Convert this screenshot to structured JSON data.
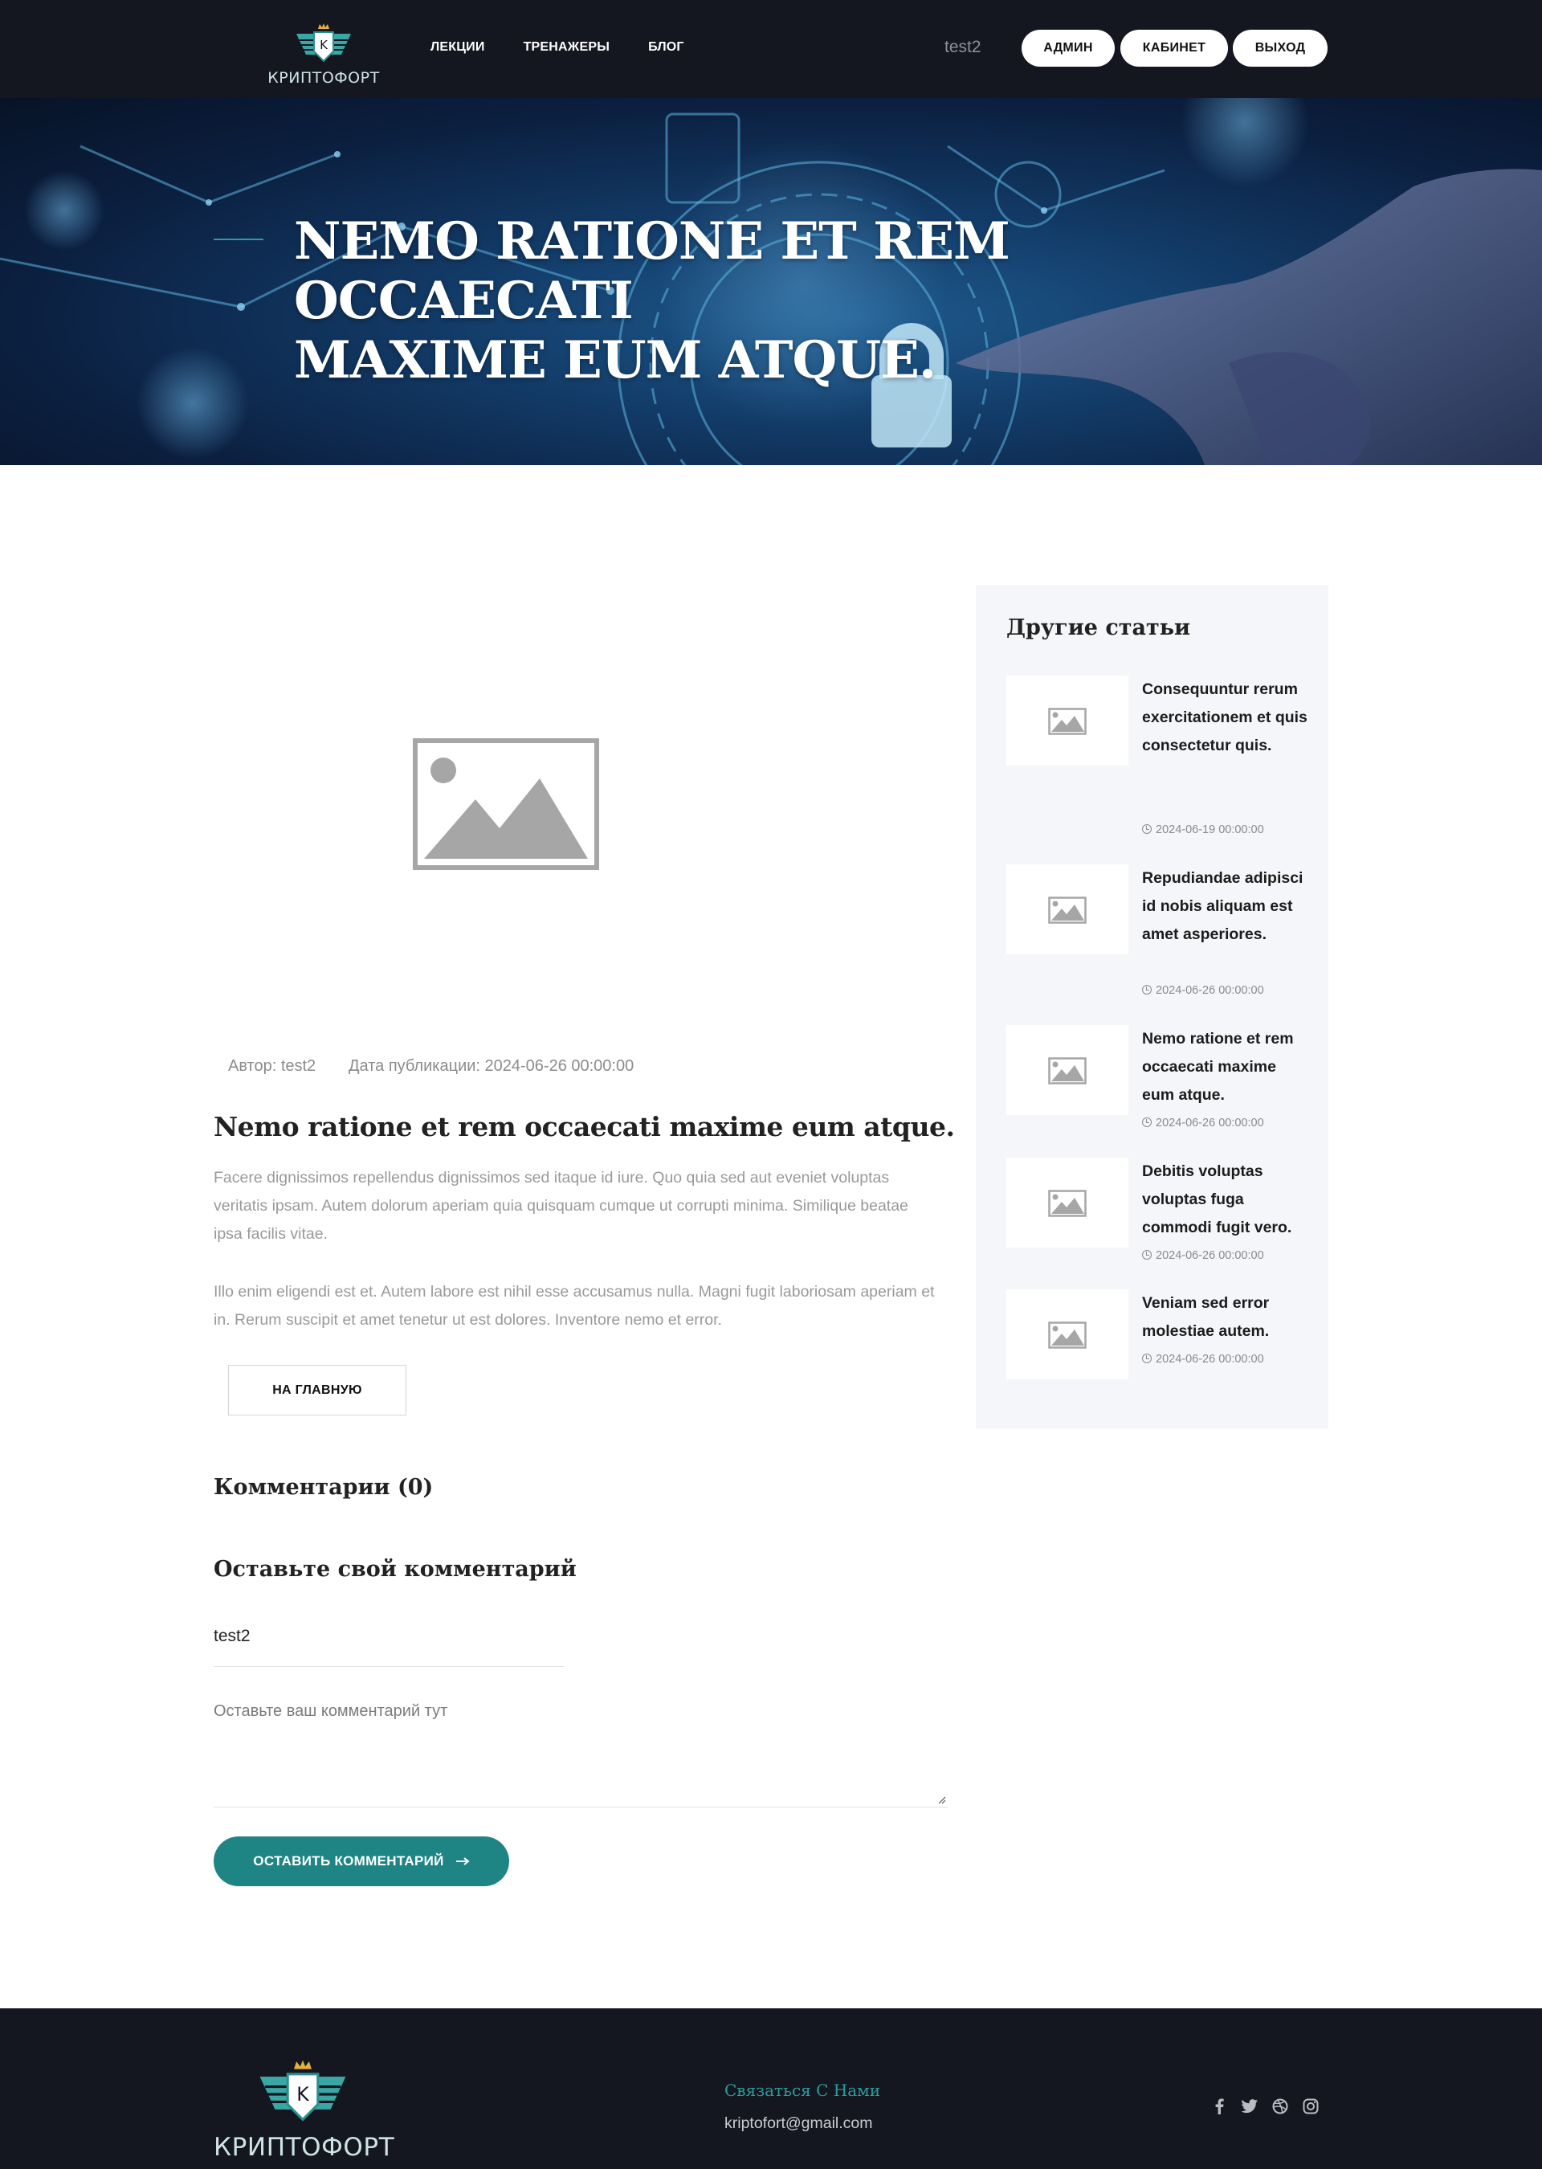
{
  "header": {
    "brand": "КРИПТОФОРТ",
    "nav": [
      "ЛЕКЦИИ",
      "ТРЕНАЖЕРЫ",
      "БЛОГ"
    ],
    "username": "test2",
    "buttons": {
      "admin": "АДМИН",
      "cabinet": "КАБИНЕТ",
      "logout": "ВЫХОД"
    }
  },
  "hero": {
    "title_line1": "NEMO RATIONE ET REM OCCAECATI",
    "title_line2": "MAXIME EUM ATQUE."
  },
  "post": {
    "author": "Автор: test2",
    "date": "Дата публикации: 2024-06-26 00:00:00",
    "title": "Nemo ratione et rem occaecati maxime eum atque.",
    "paragraphs": [
      "Facere dignissimos repellendus dignissimos sed itaque id iure. Quo quia sed aut eveniet voluptas veritatis ipsam. Autem dolorum aperiam quia quisquam cumque ut corrupti minima. Similique beatae ipsa facilis vitae.",
      "Illo enim eligendi est et. Autem labore est nihil esse accusamus nulla. Magni fugit laboriosam aperiam et in. Rerum suscipit et amet tenetur ut est dolores. Inventore nemo et error."
    ],
    "home_button": "НА ГЛАВНУЮ"
  },
  "comments": {
    "count_title": "Комментарии (0)",
    "leave_title": "Оставьте свой комментарий",
    "name_value": "test2",
    "comment_placeholder": "Оставьте ваш комментарий тут",
    "submit_label": "ОСТАВИТЬ КОММЕНТАРИЙ"
  },
  "sidebar": {
    "title": "Другие статьи",
    "items": [
      {
        "title": "Consequuntur rerum exercitationem et quis consectetur quis.",
        "date": "2024-06-19 00:00:00"
      },
      {
        "title": "Repudiandae adipisci id nobis aliquam est amet asperiores.",
        "date": "2024-06-26 00:00:00"
      },
      {
        "title": "Nemo ratione et rem occaecati maxime eum atque.",
        "date": "2024-06-26 00:00:00"
      },
      {
        "title": "Debitis voluptas voluptas fuga commodi fugit vero.",
        "date": "2024-06-26 00:00:00"
      },
      {
        "title": "Veniam sed error molestiae autem.",
        "date": "2024-06-26 00:00:00"
      }
    ]
  },
  "footer": {
    "brand": "КРИПТОФОРТ",
    "contact_title": "Связаться С Нами",
    "email": "kriptofort@gmail.com",
    "socials": [
      "facebook-icon",
      "twitter-icon",
      "dribbble-icon",
      "instagram-icon"
    ]
  },
  "colors": {
    "header_bg": "#14171f",
    "accent": "#1f8584",
    "sidebar_bg": "#f5f6f9"
  }
}
